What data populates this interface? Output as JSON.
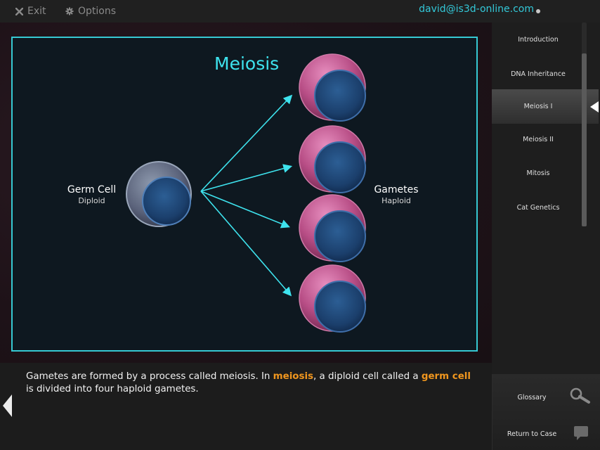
{
  "topbar": {
    "exit_label": "Exit",
    "options_label": "Options",
    "user_email": "david@is3d-online.com"
  },
  "slide": {
    "title": "Meiosis",
    "germ_cell": {
      "label": "Germ Cell",
      "sublabel": "Diploid"
    },
    "gametes": {
      "label": "Gametes",
      "sublabel": "Haploid"
    }
  },
  "sidebar": {
    "items": [
      {
        "label": "Introduction"
      },
      {
        "label": "DNA Inheritance"
      },
      {
        "label": "Meiosis I",
        "active": true
      },
      {
        "label": "Meiosis II"
      },
      {
        "label": "Mitosis"
      },
      {
        "label": "Cat Genetics"
      }
    ]
  },
  "caption": {
    "part1": "Gametes are formed by a process called meiosis. In ",
    "term1": "meiosis",
    "part2": ", a diploid cell called a ",
    "term2": "germ cell",
    "part3": " is divided into four haploid gametes."
  },
  "tools": {
    "glossary_label": "Glossary",
    "return_label": "Return to Case"
  },
  "icons": {
    "exit": "close-x-icon",
    "options": "gear-icon",
    "glossary": "search-icon",
    "return": "speech-bubble-icon",
    "back": "left-arrow-icon"
  },
  "colors": {
    "accent": "#36c9d3",
    "highlight": "#f0961e",
    "gamete_outer": "#c0568f",
    "nucleus": "#1f4a7a"
  }
}
